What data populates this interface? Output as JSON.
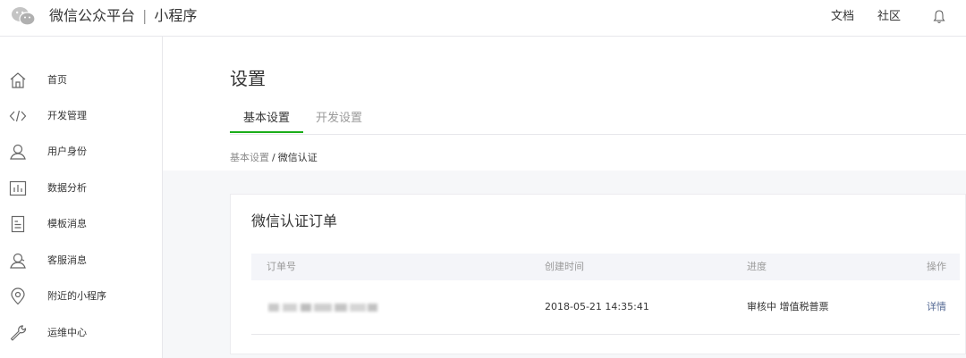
{
  "header": {
    "brand_name": "微信公众平台",
    "brand_separator": "|",
    "brand_product": "小程序",
    "links": [
      "文档",
      "社区"
    ],
    "icons": {
      "logo": "wechat-logo-icon",
      "notification": "bell-icon"
    }
  },
  "sidebar": {
    "items": [
      {
        "label": "首页",
        "icon": "home-icon"
      },
      {
        "label": "开发管理",
        "icon": "code-icon"
      },
      {
        "label": "用户身份",
        "icon": "user-icon"
      },
      {
        "label": "数据分析",
        "icon": "chart-icon"
      },
      {
        "label": "模板消息",
        "icon": "template-icon"
      },
      {
        "label": "客服消息",
        "icon": "support-icon"
      },
      {
        "label": "附近的小程序",
        "icon": "location-icon"
      },
      {
        "label": "运维中心",
        "icon": "wrench-icon"
      }
    ]
  },
  "main": {
    "title": "设置",
    "tabs": [
      {
        "label": "基本设置",
        "active": true
      },
      {
        "label": "开发设置",
        "active": false
      }
    ],
    "breadcrumb": {
      "parent": "基本设置",
      "separator": "/",
      "current": "微信认证"
    },
    "card": {
      "title": "微信认证订单",
      "table": {
        "columns": [
          "订单号",
          "创建时间",
          "进度",
          "操作"
        ],
        "rows": [
          {
            "order_no": "",
            "created": "2018-05-21 14:35:41",
            "progress": "审核中 增值税普票",
            "action": "详情"
          }
        ]
      }
    }
  },
  "colors": {
    "accent_green": "#1aad19",
    "link_blue": "#576b95",
    "muted_text": "#9a9a9a",
    "page_bg": "#f6f7f9"
  }
}
